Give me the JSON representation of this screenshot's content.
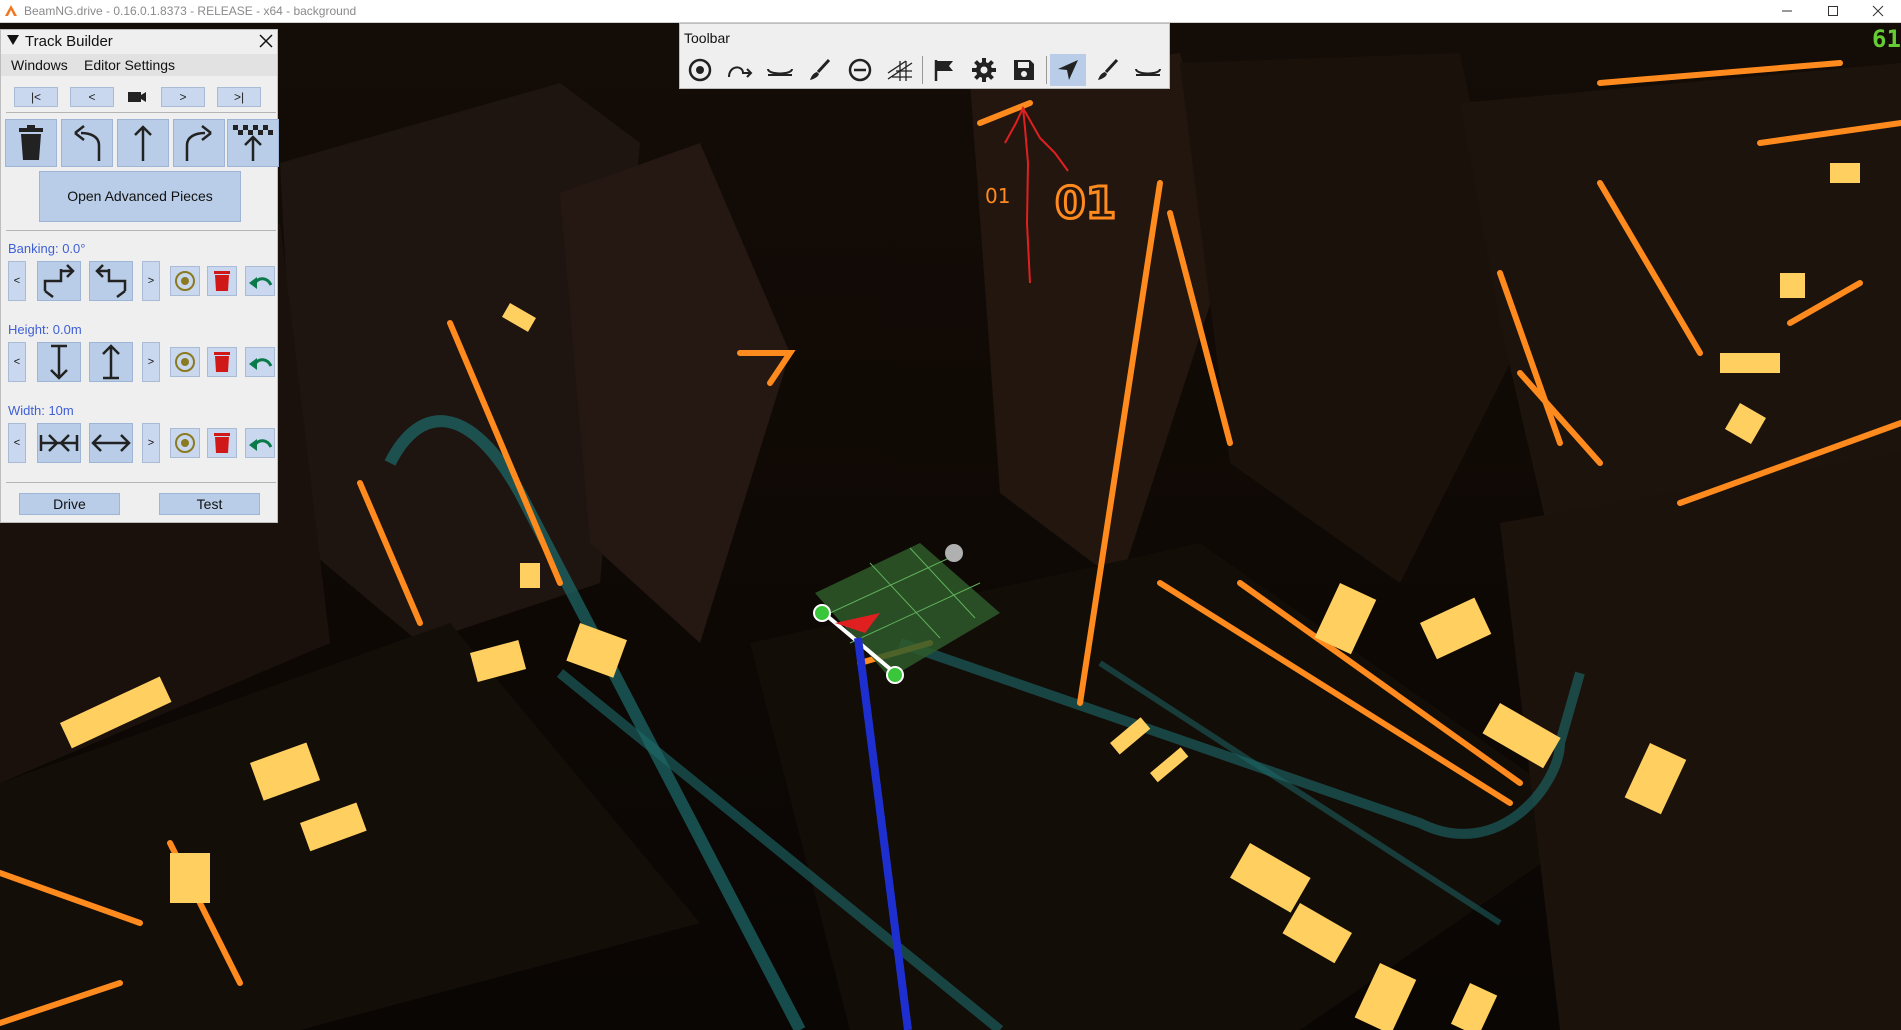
{
  "window": {
    "title": "BeamNG.drive - 0.16.0.1.8373 - RELEASE - x64 - background"
  },
  "fps": "61",
  "track_builder": {
    "title": "Track Builder",
    "menu": [
      "Windows",
      "Editor Settings"
    ],
    "nav": [
      "|<",
      "<",
      ">",
      ">|"
    ],
    "camera_icon": "camera-icon",
    "pieces": [
      "trash-icon",
      "turn-left-icon",
      "straight-icon",
      "turn-right-icon",
      "finish-line-icon"
    ],
    "advanced_button": "Open Advanced Pieces",
    "banking": {
      "label": "Banking: 0.0°",
      "prev": "<",
      "next": ">"
    },
    "height": {
      "label": "Height: 0.0m",
      "prev": "<",
      "next": ">"
    },
    "width": {
      "label": "Width: 10m",
      "prev": "<",
      "next": ">"
    },
    "drive_button": "Drive",
    "test_button": "Test"
  },
  "toolbar": {
    "title": "Toolbar",
    "buttons": [
      "target-icon",
      "path-icon",
      "road-icon",
      "brush-icon",
      "minus-circle-icon",
      "grid-ramp-icon",
      "flag-icon",
      "gear-icon",
      "save-icon",
      "navigate-icon",
      "paint-icon",
      "road-flat-icon"
    ],
    "active_index": 9
  },
  "colors": {
    "panel_bg": "#efefef",
    "button_bg": "#b9cde8",
    "label_blue": "#3f5fd4",
    "glow_orange": "#ff8a1e",
    "glow_yellow": "#ffd060",
    "teal": "#1c6b6b",
    "annotation_red": "#e02020"
  }
}
